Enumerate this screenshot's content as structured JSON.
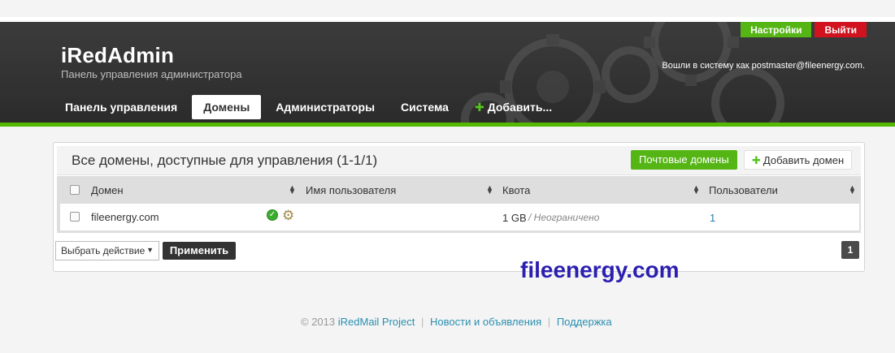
{
  "header": {
    "brand_title": "iRedAdmin",
    "brand_subtitle": "Панель управления администратора",
    "settings_label": "Настройки",
    "logout_label": "Выйти",
    "login_info": "Вошли в систему как postmaster@fileenergy.com."
  },
  "nav": {
    "items": [
      {
        "label": "Панель управления"
      },
      {
        "label": "Домены"
      },
      {
        "label": "Администраторы"
      },
      {
        "label": "Система"
      },
      {
        "label": "Добавить..."
      }
    ],
    "active_index": 1
  },
  "panel": {
    "title": "Все домены, доступные для управления (1-1/1)",
    "mail_domains_button": "Почтовые домены",
    "add_domain_button": "Добавить домен"
  },
  "table": {
    "columns": [
      "Домен",
      "Имя пользователя",
      "Квота",
      "Пользователи"
    ],
    "rows": [
      {
        "domain": "fileenergy.com",
        "username": "",
        "quota": "1 GB",
        "quota_note": "/ Неограничено",
        "users": "1"
      }
    ]
  },
  "actions": {
    "select_value": "Выбрать действие",
    "apply_label": "Применить",
    "page_number": "1"
  },
  "watermark": "fileenergy.com",
  "footer": {
    "copyright": "© 2013",
    "project_link": "iRedMail Project",
    "news_link": "Новости и объявления",
    "support_link": "Поддержка",
    "separator": "|"
  },
  "colors": {
    "accent_green": "#55b515",
    "logout_red": "#d1121f",
    "header_dark": "#333333",
    "link_blue": "#2a8fb0",
    "watermark_blue": "#2b1fb0"
  }
}
